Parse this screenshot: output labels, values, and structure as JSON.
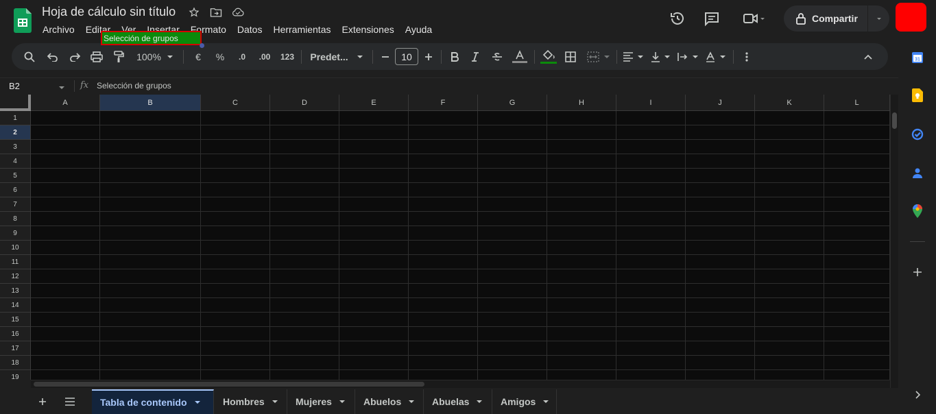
{
  "header": {
    "title": "Hoja de cálculo sin título",
    "menus": [
      "Archivo",
      "Editar",
      "Ver",
      "Insertar",
      "Formato",
      "Datos",
      "Herramientas",
      "Extensiones",
      "Ayuda"
    ],
    "share_label": "Compartir",
    "avatar_color": "#ff0000"
  },
  "toolbar": {
    "zoom": "100%",
    "currency": "€",
    "percent": "%",
    "dec_decrease": ".0",
    "dec_increase": ".00",
    "number_format": "123",
    "font": "Predet...",
    "font_size": "10"
  },
  "formula_bar": {
    "cell_ref": "B2",
    "fx": "fx",
    "content": "Selección de grupos"
  },
  "grid": {
    "columns": [
      "A",
      "B",
      "C",
      "D",
      "E",
      "F",
      "G",
      "H",
      "I",
      "J",
      "K",
      "L"
    ],
    "rows": [
      "1",
      "2",
      "3",
      "4",
      "5",
      "6",
      "7",
      "8",
      "9",
      "10",
      "11",
      "12",
      "13",
      "14",
      "15",
      "16",
      "17",
      "18",
      "19"
    ],
    "selected_column": "B",
    "selected_row": "2",
    "cell_b2": {
      "value": "Selección de grupos",
      "fill_color": "#0b8a0b",
      "border_color": "#d50000"
    }
  },
  "sheets": [
    {
      "name": "Tabla de contenido",
      "active": true
    },
    {
      "name": "Hombres",
      "active": false
    },
    {
      "name": "Mujeres",
      "active": false
    },
    {
      "name": "Abuelos",
      "active": false
    },
    {
      "name": "Abuelas",
      "active": false
    },
    {
      "name": "Amigos",
      "active": false
    }
  ],
  "colors": {
    "accent_blue": "#a8c7fa",
    "background": "#1f1f1f",
    "grid_bg": "#0c0c0c",
    "sheets_green": "#0f9d58"
  }
}
